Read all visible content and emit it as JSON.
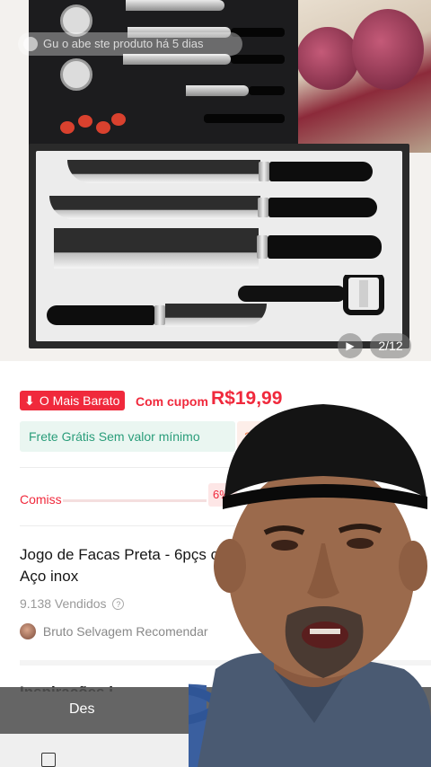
{
  "gallery": {
    "ghost_banner": "Gu  o  abe  ste produto há 5 dias",
    "counter": "2/12",
    "play_icon": "play-icon"
  },
  "price_row": {
    "badge_text": "O Mais Barato",
    "badge_icon": "down-arrow-icon",
    "coupon_label": "Com cupom",
    "price": "R$19,99"
  },
  "shipping": {
    "free_label": "Frete Grátis Sem valor mínimo",
    "secondary_label": "2"
  },
  "commission": {
    "label": "Comiss",
    "rate": "6%"
  },
  "product": {
    "title": "Jogo de Facas Preta - 6pçs c Aço inox",
    "sold": "9.138 Vendidos",
    "recommender": "Bruto Selvagem Recomendar",
    "next_heading": "Inspirações i"
  },
  "bottom": {
    "overlay_text": "Des"
  },
  "colors": {
    "accent_red": "#f0293c",
    "shipping_green": "#2a9d7a"
  }
}
